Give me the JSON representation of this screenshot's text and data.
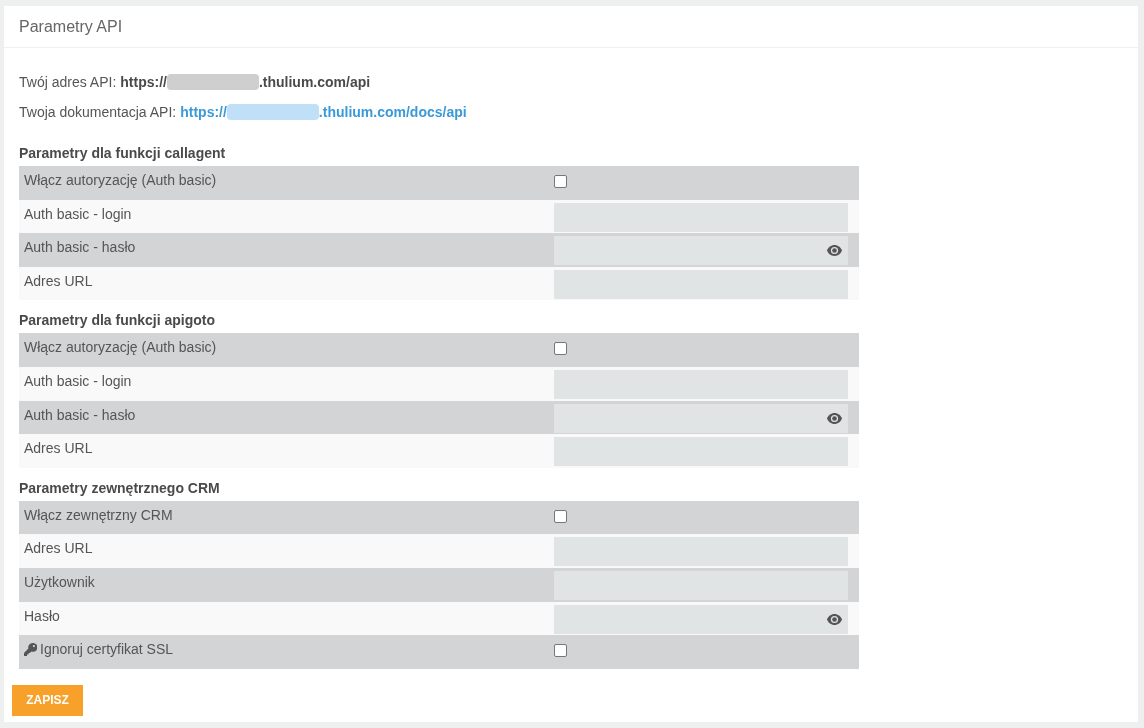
{
  "panel": {
    "title": "Parametry API"
  },
  "api_info": [
    {
      "kind": "text",
      "label": "Twój adres API:",
      "url_start": "https://",
      "url_end": ".thulium.com/api"
    },
    {
      "kind": "link",
      "label": "Twoja dokumentacja API:",
      "url_start": "https://",
      "url_end": ".thulium.com/docs/api"
    }
  ],
  "sections": [
    {
      "title": "Parametry dla funkcji callagent",
      "rows": [
        {
          "kind": "checkbox",
          "label": "Włącz autoryzację (Auth basic)",
          "checked": false
        },
        {
          "kind": "text",
          "label": "Auth basic - login"
        },
        {
          "kind": "password",
          "label": "Auth basic - hasło"
        },
        {
          "kind": "text",
          "label": "Adres URL"
        }
      ]
    },
    {
      "title": "Parametry dla funkcji apigoto",
      "rows": [
        {
          "kind": "checkbox",
          "label": "Włącz autoryzację (Auth basic)",
          "checked": false
        },
        {
          "kind": "text",
          "label": "Auth basic - login"
        },
        {
          "kind": "password",
          "label": "Auth basic - hasło"
        },
        {
          "kind": "text",
          "label": "Adres URL"
        }
      ]
    },
    {
      "title": "Parametry zewnętrznego CRM",
      "rows": [
        {
          "kind": "checkbox",
          "label": "Włącz zewnętrzny CRM",
          "checked": false
        },
        {
          "kind": "text",
          "label": "Adres URL"
        },
        {
          "kind": "text",
          "label": "Użytkownik"
        },
        {
          "kind": "password",
          "label": "Hasło"
        },
        {
          "kind": "checkbox",
          "label": "Ignoruj certyfikat SSL",
          "checked": false,
          "with_icon": true
        }
      ]
    }
  ],
  "save_button": {
    "label": "ZAPISZ"
  }
}
